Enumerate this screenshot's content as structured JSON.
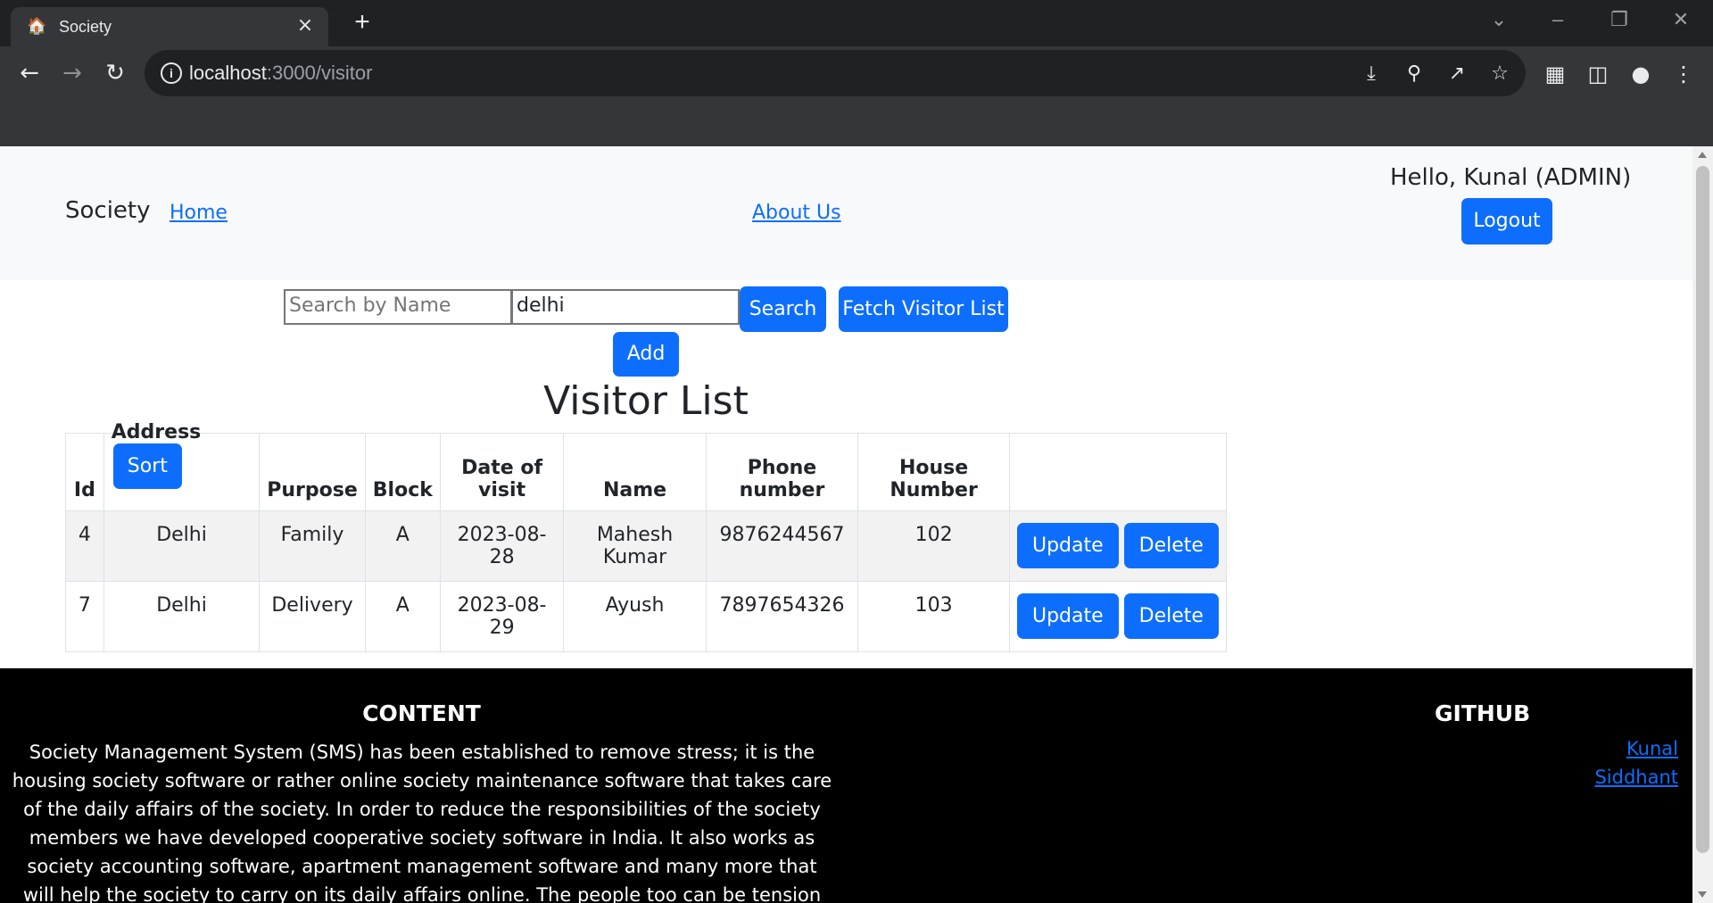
{
  "browser": {
    "tab_title": "Society",
    "tab_icon": "house-favicon",
    "url_host": "localhost",
    "url_path": ":3000/visitor"
  },
  "navbar": {
    "brand": "Society",
    "home_link": "Home",
    "about_link": "About Us",
    "greeting": "Hello, Kunal (ADMIN)",
    "logout_label": "Logout"
  },
  "search": {
    "name_placeholder": "Search by Name",
    "name_value": "",
    "address_value": "delhi",
    "search_label": "Search",
    "fetch_label": "Fetch Visitor List",
    "add_label": "Add"
  },
  "page_title": "Visitor List",
  "table": {
    "headers": {
      "id": "Id",
      "address": "Address",
      "sort_label": "Sort",
      "purpose": "Purpose",
      "block": "Block",
      "date": "Date of visit",
      "name": "Name",
      "phone": "Phone number",
      "house": "House Number"
    },
    "rows": [
      {
        "id": "4",
        "address": "Delhi",
        "purpose": "Family",
        "block": "A",
        "date": "2023-08-28",
        "name": "Mahesh Kumar",
        "phone": "9876244567",
        "house": "102",
        "update_label": "Update",
        "delete_label": "Delete"
      },
      {
        "id": "7",
        "address": "Delhi",
        "purpose": "Delivery",
        "block": "A",
        "date": "2023-08-29",
        "name": "Ayush",
        "phone": "7897654326",
        "house": "103",
        "update_label": "Update",
        "delete_label": "Delete"
      }
    ]
  },
  "footer": {
    "content_title": "CONTENT",
    "content_text": "Society Management System (SMS) has been established to remove stress; it is the housing society software or rather online society maintenance software that takes care of the daily affairs of the society. In order to reduce the responsibilities of the society members we have developed cooperative society software in India. It also works as society accounting software, apartment management software and many more that will help the society to carry on its daily affairs online. The people too can be tension free because the accounts of the society will be handled",
    "github_title": "GITHUB",
    "github_links": [
      "Kunal",
      "Siddhant"
    ]
  },
  "colors": {
    "primary": "#0d6efd",
    "navbar_bg": "#f8f9fa",
    "footer_bg": "#000000",
    "chrome_bg": "#35363a",
    "tabstrip_bg": "#202124"
  }
}
